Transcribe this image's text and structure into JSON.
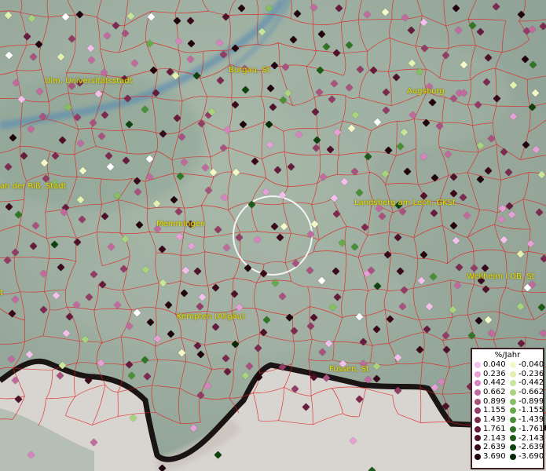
{
  "map": {
    "cities": [
      {
        "id": "ulm",
        "name": "Ulm, Universitätsstadt"
      },
      {
        "id": "burgau",
        "name": "Burgau, St"
      },
      {
        "id": "augsburg",
        "name": "Augsburg"
      },
      {
        "id": "rib",
        "name": "an der Riß, Stadt"
      },
      {
        "id": "memmingen",
        "name": "Memmingen"
      },
      {
        "id": "landsberg",
        "name": "Landsberg am Lech, GKSt"
      },
      {
        "id": "weilheim",
        "name": "Weilheim i.OB, St"
      },
      {
        "id": "kempten",
        "name": "Kempten (Allgäu)"
      },
      {
        "id": "fuessen",
        "name": "Füssen, St"
      },
      {
        "id": "edge",
        "name": "t"
      }
    ],
    "legend": {
      "title": "%/Jahr",
      "positive": [
        {
          "label": "0.040",
          "color": "#f2c0ea"
        },
        {
          "label": "0.236",
          "color": "#e6a0d6"
        },
        {
          "label": "0.442",
          "color": "#d585bd"
        },
        {
          "label": "0.662",
          "color": "#c06a9e"
        },
        {
          "label": "0.899",
          "color": "#aa527f"
        },
        {
          "label": "1.155",
          "color": "#933c66"
        },
        {
          "label": "1.439",
          "color": "#7d2a50"
        },
        {
          "label": "1.761",
          "color": "#661c3c"
        },
        {
          "label": "2.143",
          "color": "#50122b"
        },
        {
          "label": "2.639",
          "color": "#3a0a1c"
        },
        {
          "label": "3.690",
          "color": "#22040e"
        }
      ],
      "negative": [
        {
          "label": "-0.040",
          "color": "#f4f7c8"
        },
        {
          "label": "-0.236",
          "color": "#e2f0b0"
        },
        {
          "label": "-0.442",
          "color": "#c8e59a"
        },
        {
          "label": "-0.662",
          "color": "#a8d47e"
        },
        {
          "label": "-0.899",
          "color": "#86bf62"
        },
        {
          "label": "-1.155",
          "color": "#66a84a"
        },
        {
          "label": "-1.439",
          "color": "#4a8f36"
        },
        {
          "label": "-1.761",
          "color": "#317626"
        },
        {
          "label": "-2.143",
          "color": "#1c5c18"
        },
        {
          "label": "-2.639",
          "color": "#0e420e"
        },
        {
          "label": "-3.690",
          "color": "#052a06"
        }
      ]
    }
  }
}
